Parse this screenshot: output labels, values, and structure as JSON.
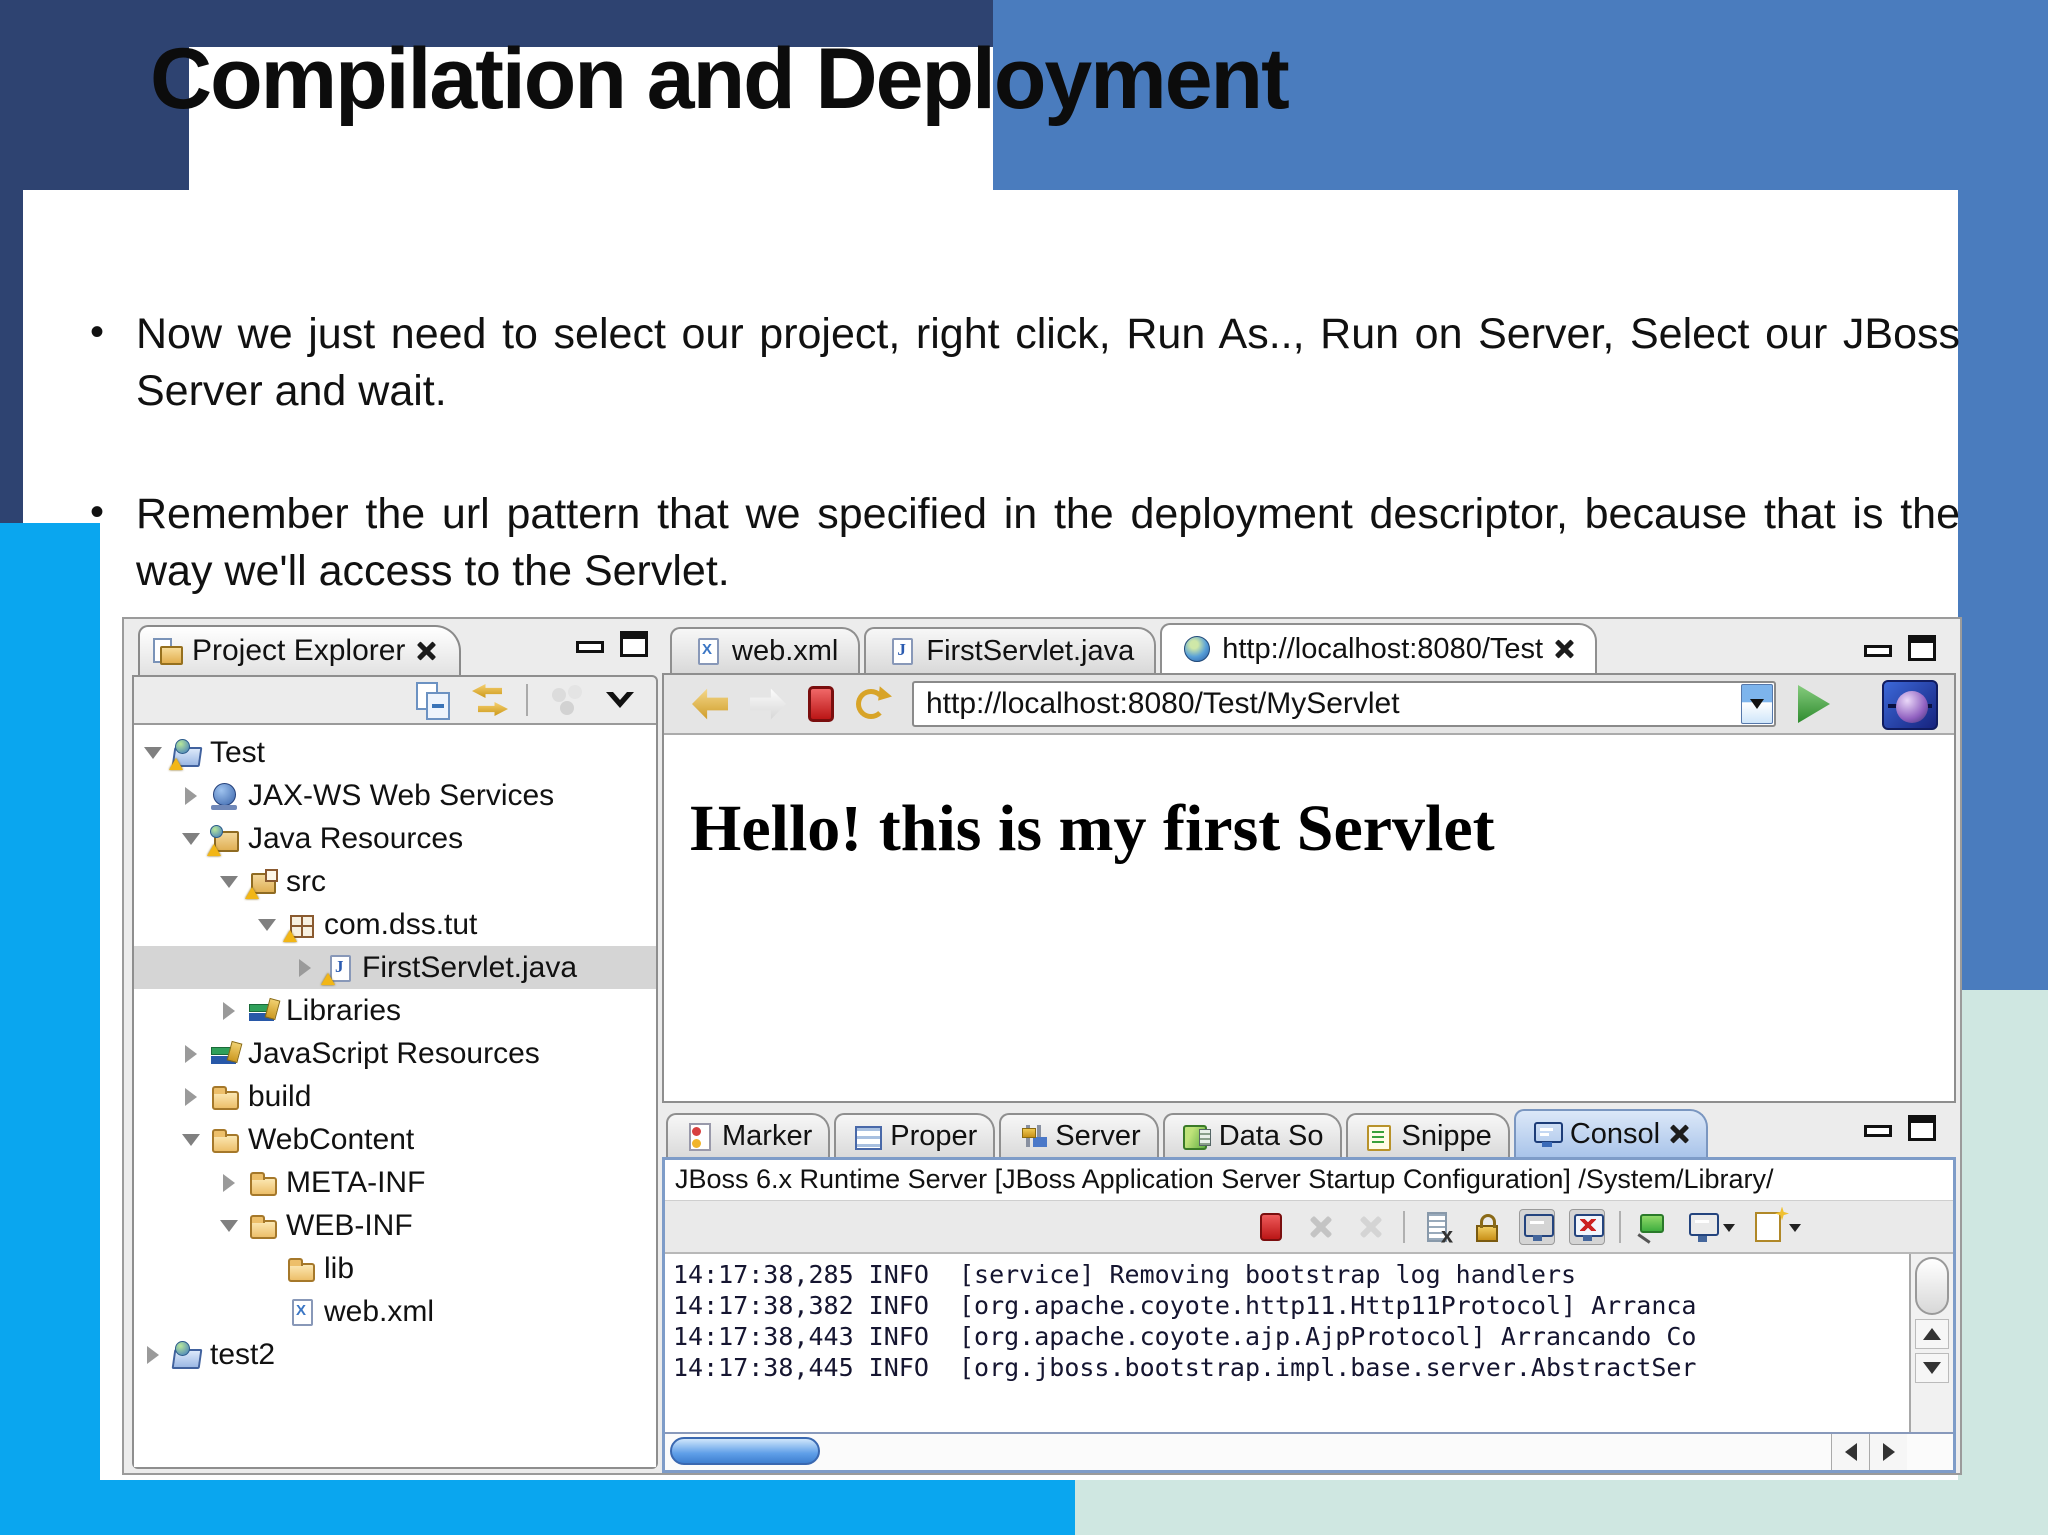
{
  "slide": {
    "title": "Compilation and Deployment",
    "bullets": [
      "Now we just need to select our project, right click, Run As.., Run on Server, Select our JBoss Server and wait.",
      "Remember the url pattern that we specified in the deployment descriptor, because that is the way we'll access to the Servlet."
    ],
    "colors": {
      "navy": "#2e4371",
      "blue": "#4a7cbe",
      "cyan": "#0aa6ef",
      "mint": "#cfe7e1"
    }
  },
  "explorer": {
    "tab_label": "Project Explorer",
    "toolbar": [
      {
        "icon": "collapse-all"
      },
      {
        "icon": "link-editor"
      },
      {
        "icon": "separator"
      },
      {
        "icon": "synced-dots"
      },
      {
        "icon": "view-menu"
      }
    ],
    "tree": [
      {
        "label": "Test",
        "icon": "java-project",
        "arrow": "expanded",
        "level": 0,
        "warn": true
      },
      {
        "label": "JAX-WS Web Services",
        "icon": "webservices",
        "arrow": "collapsed",
        "level": 1
      },
      {
        "label": "Java Resources",
        "icon": "java-resources",
        "arrow": "expanded",
        "level": 1,
        "warn": true
      },
      {
        "label": "src",
        "icon": "source-folder",
        "arrow": "expanded",
        "level": 2,
        "warn": true
      },
      {
        "label": "com.dss.tut",
        "icon": "package",
        "arrow": "expanded",
        "level": 3,
        "warn": true
      },
      {
        "label": "FirstServlet.java",
        "icon": "java-file",
        "arrow": "collapsed",
        "level": 4,
        "warn": true,
        "selected": true
      },
      {
        "label": "Libraries",
        "icon": "libraries",
        "arrow": "collapsed",
        "level": 2
      },
      {
        "label": "JavaScript Resources",
        "icon": "libraries",
        "arrow": "collapsed",
        "level": 1
      },
      {
        "label": "build",
        "icon": "folder",
        "arrow": "collapsed",
        "level": 1
      },
      {
        "label": "WebContent",
        "icon": "folder",
        "arrow": "expanded",
        "level": 1
      },
      {
        "label": "META-INF",
        "icon": "folder",
        "arrow": "collapsed",
        "level": 2
      },
      {
        "label": "WEB-INF",
        "icon": "folder",
        "arrow": "expanded",
        "level": 2
      },
      {
        "label": "lib",
        "icon": "folder",
        "arrow": "none",
        "level": 3
      },
      {
        "label": "web.xml",
        "icon": "xml-file",
        "arrow": "none",
        "level": 3
      },
      {
        "label": "test2",
        "icon": "java-project",
        "arrow": "collapsed",
        "level": 0
      }
    ]
  },
  "editor": {
    "tabs": [
      {
        "label": "web.xml",
        "icon": "xml-file"
      },
      {
        "label": "FirstServlet.java",
        "icon": "java-file"
      },
      {
        "label": "http://localhost:8080/Test",
        "icon": "globe",
        "active": true,
        "closable": true
      }
    ],
    "browser": {
      "url": "http://localhost:8080/Test/MyServlet",
      "page_text": "Hello! this is my first Servlet"
    }
  },
  "console": {
    "tabs": [
      {
        "label": "Marker",
        "icon": "marker"
      },
      {
        "label": "Proper",
        "icon": "properties"
      },
      {
        "label": "Server",
        "icon": "servers"
      },
      {
        "label": "Data So",
        "icon": "data-source"
      },
      {
        "label": "Snippe",
        "icon": "snippets"
      },
      {
        "label": "Consol",
        "icon": "console",
        "active": true,
        "closable": true
      }
    ],
    "title_line": "JBoss 6.x Runtime Server [JBoss Application Server Startup Configuration] /System/Library/",
    "toolbar": [
      {
        "icon": "stop"
      },
      {
        "icon": "clear-x",
        "disabled": true
      },
      {
        "icon": "clear-xx",
        "disabled": true
      },
      {
        "icon": "separator"
      },
      {
        "icon": "clear-console"
      },
      {
        "icon": "scroll-lock"
      },
      {
        "icon": "monitor-a",
        "pressed": true
      },
      {
        "icon": "monitor-b",
        "pressed": true
      },
      {
        "icon": "separator"
      },
      {
        "icon": "pin-console"
      },
      {
        "icon": "console-select",
        "dropdown": true
      },
      {
        "icon": "new-console",
        "dropdown": true
      }
    ],
    "lines": [
      "14:17:38,285 INFO  [service] Removing bootstrap log handlers",
      "14:17:38,382 INFO  [org.apache.coyote.http11.Http11Protocol] Arranca",
      "14:17:38,443 INFO  [org.apache.coyote.ajp.AjpProtocol] Arrancando Co",
      "14:17:38,445 INFO  [org.jboss.bootstrap.impl.base.server.AbstractSer"
    ]
  }
}
